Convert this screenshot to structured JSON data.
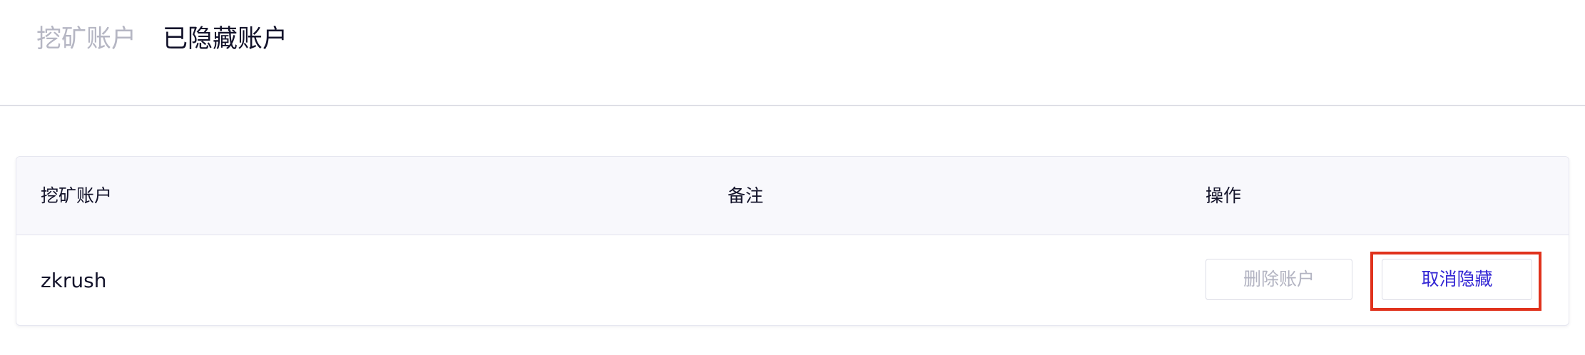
{
  "tabs": [
    {
      "label": "挖矿账户",
      "active": false
    },
    {
      "label": "已隐藏账户",
      "active": true
    }
  ],
  "table": {
    "headers": [
      "挖矿账户",
      "备注",
      "操作"
    ],
    "rows": [
      {
        "account": "zkrush",
        "remark": "",
        "actions": {
          "delete_label": "删除账户",
          "unhide_label": "取消隐藏"
        }
      }
    ]
  },
  "colors": {
    "active_tab": "#12122a",
    "inactive_tab": "#b5b6c3",
    "link_blue": "#3427d4",
    "highlight_red": "#e0321c"
  }
}
